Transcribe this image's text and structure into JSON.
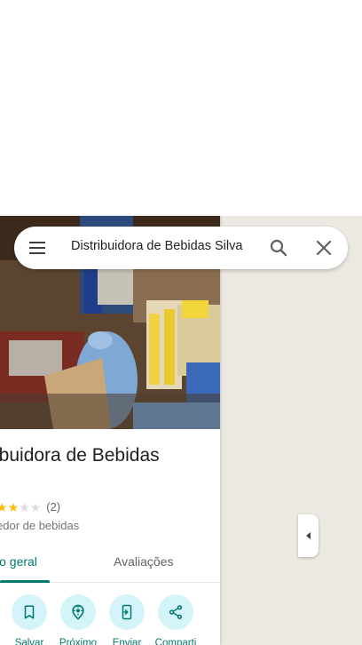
{
  "search": {
    "query": "Distribuidora de Bebidas Silva"
  },
  "place": {
    "title": "ibuidora de Bebidas",
    "rating_value": 2.5,
    "rating_max": 5,
    "review_count": "(2)",
    "category": "edor de bebidas"
  },
  "tabs": {
    "overview": "io geral",
    "reviews": "Avaliações"
  },
  "actions": [
    {
      "label": "Salvar",
      "icon": "bookmark-icon"
    },
    {
      "label": "Próximo",
      "icon": "nearby-icon"
    },
    {
      "label": "Enviar",
      "icon": "send-to-phone-icon"
    },
    {
      "label": "Comparti",
      "icon": "share-icon"
    }
  ],
  "colors": {
    "accent": "#00796b",
    "action_bg": "#d4f4f9",
    "star": "#fbbc04",
    "map_bg": "#ece8e2"
  }
}
